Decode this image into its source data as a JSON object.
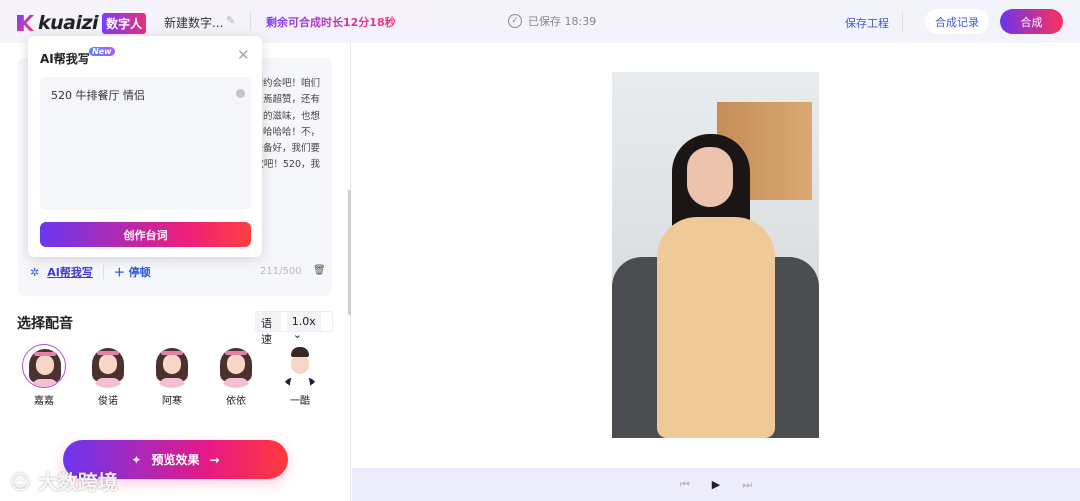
{
  "header": {
    "logo_text": "kuaizi",
    "logo_badge": "数字人",
    "project_name": "新建数字...",
    "remaining": "剩余可合成时长12分18秒",
    "saved_status": "已保存 18:39",
    "save_project": "保存工程",
    "history": "合成记录",
    "synthesize": "合成"
  },
  "script": {
    "fragments": [
      "的约会吧！咱们",
      "焉超赞，还有",
      "的滋味，也想",
      "，哈哈哈！不",
      "准备好，我们要",
      "欢吧！520，我"
    ],
    "ai_write": "AI帮我写",
    "add_pause": "停顿",
    "char_count": "211/500"
  },
  "ai_popup": {
    "title": "AI帮我写",
    "badge": "New",
    "input_value": "520 牛排餐厅 情侣",
    "create_button": "创作台词"
  },
  "voice": {
    "title": "选择配音",
    "speed_label": "语速",
    "speed_value": "1.0x",
    "voices": [
      {
        "name": "嘉嘉",
        "selected": true
      },
      {
        "name": "俊诺"
      },
      {
        "name": "阿寒"
      },
      {
        "name": "依依"
      },
      {
        "name": "一酷"
      }
    ]
  },
  "preview_button": "预览效果",
  "watermark": "大数跨境"
}
